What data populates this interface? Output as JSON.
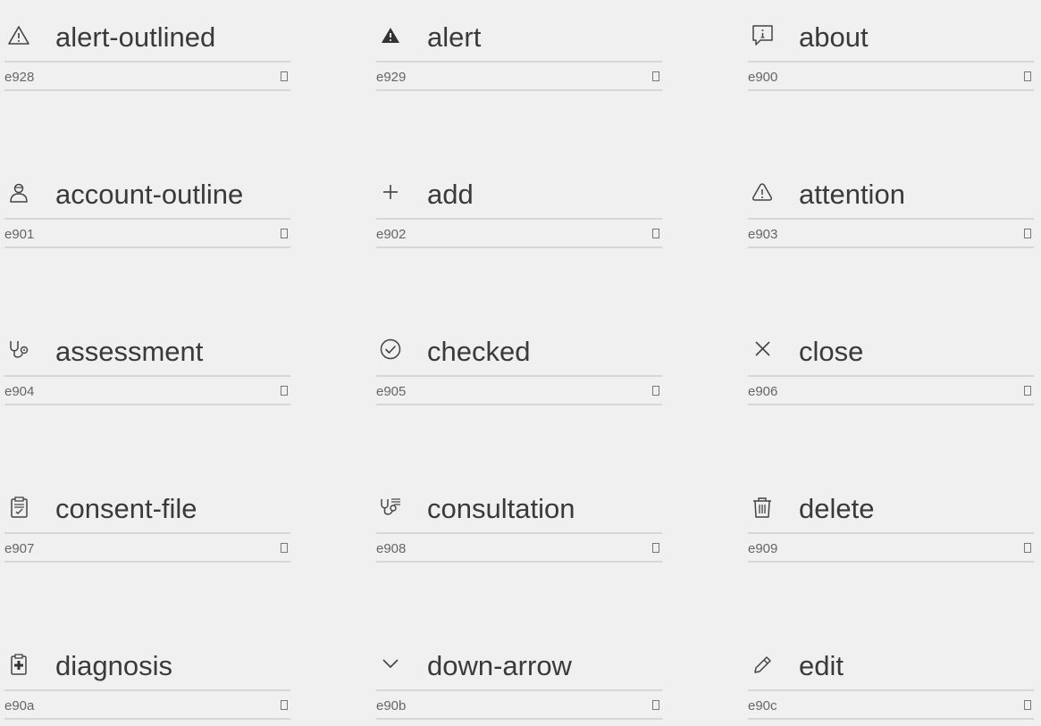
{
  "icons": [
    {
      "name": "alert-outlined",
      "code": "e928",
      "icon": "alert-outlined-icon"
    },
    {
      "name": "alert",
      "code": "e929",
      "icon": "alert-icon"
    },
    {
      "name": "about",
      "code": "e900",
      "icon": "about-icon"
    },
    {
      "name": "account-outline",
      "code": "e901",
      "icon": "account-outline-icon"
    },
    {
      "name": "add",
      "code": "e902",
      "icon": "add-icon"
    },
    {
      "name": "attention",
      "code": "e903",
      "icon": "attention-icon"
    },
    {
      "name": "assessment",
      "code": "e904",
      "icon": "assessment-icon"
    },
    {
      "name": "checked",
      "code": "e905",
      "icon": "checked-icon"
    },
    {
      "name": "close",
      "code": "e906",
      "icon": "close-icon"
    },
    {
      "name": "consent-file",
      "code": "e907",
      "icon": "consent-file-icon"
    },
    {
      "name": "consultation",
      "code": "e908",
      "icon": "consultation-icon"
    },
    {
      "name": "delete",
      "code": "e909",
      "icon": "delete-icon"
    },
    {
      "name": "diagnosis",
      "code": "e90a",
      "icon": "diagnosis-icon"
    },
    {
      "name": "down-arrow",
      "code": "e90b",
      "icon": "down-arrow-icon"
    },
    {
      "name": "edit",
      "code": "e90c",
      "icon": "edit-icon"
    }
  ],
  "colors": {
    "background": "#f0f0f0",
    "text": "#3a3a3a",
    "divider": "#d6d6d6",
    "code_text": "#666666"
  }
}
